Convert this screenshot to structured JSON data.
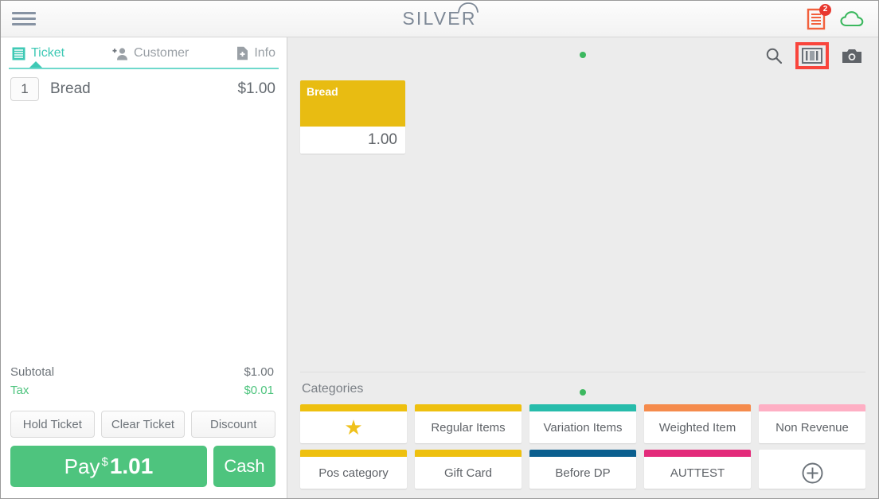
{
  "topbar": {
    "menu_icon": "hamburger-menu-icon",
    "brand": "SILVER",
    "brand_mark_icon": "cloud-arc-icon",
    "receipt_icon": "receipt-icon",
    "receipt_badge": "2",
    "cloud_icon": "cloud-icon"
  },
  "colors": {
    "accent_teal": "#3fc9b5",
    "pay_green": "#4ec47e",
    "tax_green": "#4ec47e",
    "badge_red": "#e8372e",
    "highlight_red": "#f9453c",
    "receipt_orange": "#f2603c",
    "cloud_green": "#3cb85f",
    "dot_green": "#3cb85f",
    "item_yellow": "#e8bc12"
  },
  "left_panel": {
    "tabs": [
      {
        "label": "Ticket",
        "icon": "ticket-list-icon",
        "active": true
      },
      {
        "label": "Customer",
        "icon": "add-person-icon",
        "active": false
      },
      {
        "label": "Info",
        "icon": "add-document-icon",
        "active": false
      }
    ],
    "items": [
      {
        "qty": "1",
        "name": "Bread",
        "price": "$1.00"
      }
    ],
    "totals": [
      {
        "label": "Subtotal",
        "value": "$1.00",
        "kind": "subtotal"
      },
      {
        "label": "Tax",
        "value": "$0.01",
        "kind": "tax"
      }
    ],
    "actions": [
      {
        "label": "Hold Ticket"
      },
      {
        "label": "Clear Ticket"
      },
      {
        "label": "Discount"
      }
    ],
    "pay": {
      "word": "Pay",
      "currency": "$",
      "amount": "1.01",
      "cash_label": "Cash"
    }
  },
  "right_panel": {
    "toolbar": [
      {
        "icon": "search-icon",
        "highlighted": false
      },
      {
        "icon": "barcode-icon",
        "highlighted": true
      },
      {
        "icon": "camera-icon",
        "highlighted": false
      }
    ],
    "items_page_dot": "page-indicator-dot",
    "items": [
      {
        "name": "Bread",
        "price": "1.00",
        "color": "#e8bc12"
      }
    ],
    "categories_title": "Categories",
    "categories_page_dot": "page-indicator-dot",
    "categories": [
      {
        "label": "",
        "icon": "star-icon",
        "color": "#eec00f"
      },
      {
        "label": "Regular Items",
        "icon": "",
        "color": "#eec00f"
      },
      {
        "label": "Variation Items",
        "icon": "",
        "color": "#27bcab"
      },
      {
        "label": "Weighted Item",
        "icon": "",
        "color": "#f58b4c"
      },
      {
        "label": "Non Revenue",
        "icon": "",
        "color": "#feafc4"
      },
      {
        "label": "Pos category",
        "icon": "",
        "color": "#eec00f"
      },
      {
        "label": "Gift Card",
        "icon": "",
        "color": "#eec00f"
      },
      {
        "label": "Before DP",
        "icon": "",
        "color": "#0b5f8f"
      },
      {
        "label": "AUTTEST",
        "icon": "",
        "color": "#e32b7a"
      },
      {
        "label": "",
        "icon": "plus-circle-icon",
        "color": ""
      }
    ]
  }
}
